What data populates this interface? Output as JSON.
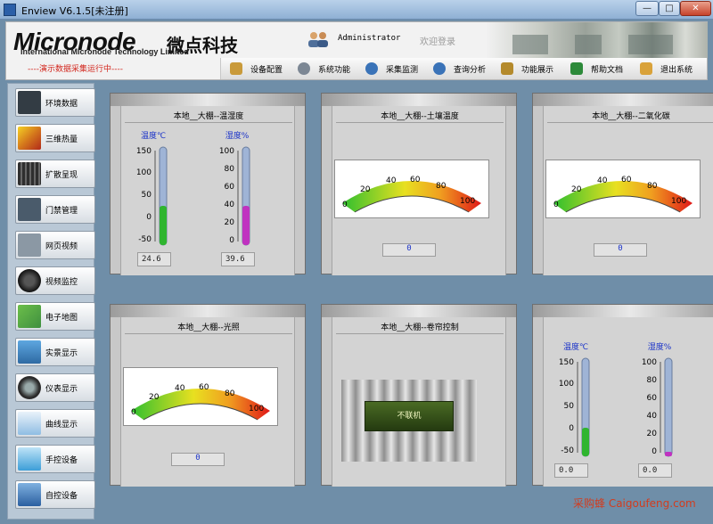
{
  "window": {
    "title": "Enview V6.1.5[未注册]",
    "min": "—",
    "max": "□",
    "close": "✕"
  },
  "header": {
    "logo": "Micronode",
    "logo_cn": "微点科技",
    "logo_sub": "International Micronode Technology Limited",
    "user": "Administrator",
    "login": "欢迎登录",
    "status": "----演示数据采集运行中----"
  },
  "menu": [
    {
      "label": "设备配置",
      "icon": "tools-icon",
      "color": "#c99a3a"
    },
    {
      "label": "系统功能",
      "icon": "gear-icon",
      "color": "#7c8794"
    },
    {
      "label": "采集监测",
      "icon": "magnifier-icon",
      "color": "#3a73b8"
    },
    {
      "label": "查询分析",
      "icon": "search-icon",
      "color": "#3a73b8"
    },
    {
      "label": "功能展示",
      "icon": "display-icon",
      "color": "#b48a2c"
    },
    {
      "label": "帮助文档",
      "icon": "book-icon",
      "color": "#2d8a3a"
    },
    {
      "label": "退出系统",
      "icon": "exit-icon",
      "color": "#d9a23a"
    }
  ],
  "sidebar": [
    {
      "label": "环境数据",
      "icon": "thermometer-device-icon",
      "color": "#333c44"
    },
    {
      "label": "三维热量",
      "icon": "heatmap-icon",
      "color": "#d4781c"
    },
    {
      "label": "扩散呈现",
      "icon": "server-icon",
      "color": "#2e2e2e"
    },
    {
      "label": "门禁管理",
      "icon": "door-icon",
      "color": "#4a5b6b"
    },
    {
      "label": "网页视频",
      "icon": "camera-icon",
      "color": "#8b98a4"
    },
    {
      "label": "视频监控",
      "icon": "dome-camera-icon",
      "color": "#222222"
    },
    {
      "label": "电子地图",
      "icon": "map-icon",
      "color": "#3f8f3f"
    },
    {
      "label": "实景显示",
      "icon": "monitor-icon",
      "color": "#2e6aa3"
    },
    {
      "label": "仪表显示",
      "icon": "gauge-icon",
      "color": "#2b2b2b"
    },
    {
      "label": "曲线显示",
      "icon": "chart-icon",
      "color": "#2f7fb8"
    },
    {
      "label": "手控设备",
      "icon": "hand-icon",
      "color": "#3d9ed8"
    },
    {
      "label": "自控设备",
      "icon": "auto-device-icon",
      "color": "#2b5fa0"
    }
  ],
  "panels": {
    "p1": {
      "title": "本地__大棚--温湿度",
      "temp_label": "温度℃",
      "hum_label": "湿度%",
      "temp_ticks": [
        "150",
        "100",
        "50",
        "0",
        "-50"
      ],
      "hum_ticks": [
        "100",
        "80",
        "60",
        "40",
        "20",
        "0"
      ],
      "temp_value": "24.6",
      "hum_value": "39.6"
    },
    "p2": {
      "title": "本地__大棚--土壤温度",
      "ticks": [
        "0",
        "20",
        "40",
        "60",
        "80",
        "100"
      ],
      "value": "0"
    },
    "p3": {
      "title": "本地__大棚--二氧化碳",
      "ticks": [
        "0",
        "20",
        "40",
        "60",
        "80",
        "100"
      ],
      "value": "0"
    },
    "p4": {
      "title": "本地__大棚--光照",
      "ticks": [
        "0",
        "20",
        "40",
        "60",
        "80",
        "100"
      ],
      "value": "0"
    },
    "p5": {
      "title": "本地__大棚--卷帘控制",
      "button": "不联机"
    },
    "p6": {
      "temp_label": "温度℃",
      "hum_label": "湿度%",
      "temp_ticks": [
        "150",
        "100",
        "50",
        "0",
        "-50"
      ],
      "hum_ticks": [
        "100",
        "80",
        "60",
        "40",
        "20",
        "0"
      ],
      "temp_value": "0.0",
      "hum_value": "0.0"
    }
  },
  "watermark": "采购蜂 Caigoufeng.com"
}
